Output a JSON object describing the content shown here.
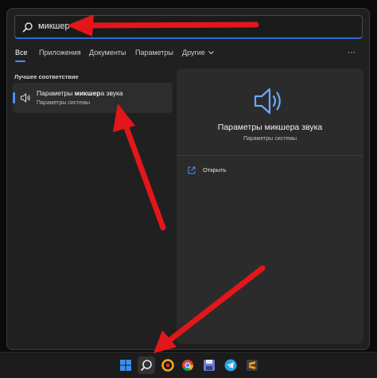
{
  "search": {
    "value": "микшер"
  },
  "tabs": [
    {
      "label": "Все",
      "active": true
    },
    {
      "label": "Приложения"
    },
    {
      "label": "Документы"
    },
    {
      "label": "Параметры"
    },
    {
      "label": "Другие"
    }
  ],
  "tabs_more_icon": "chevron-down-icon",
  "overflow_menu": "⋯",
  "best_match": {
    "section_title": "Лучшее соответствие",
    "title_prefix": "Параметры ",
    "title_bold": "микшер",
    "title_suffix": "а звука",
    "subtitle": "Параметры системы",
    "icon": "speaker-icon"
  },
  "detail": {
    "title": "Параметры микшера звука",
    "subtitle": "Параметры системы",
    "open_label": "Открыть",
    "icon": "speaker-icon"
  },
  "taskbar": {
    "icons": [
      "windows-start-icon",
      "search-icon",
      "yandex-browser-icon",
      "chrome-icon",
      "save-icon",
      "telegram-icon",
      "sublime-text-icon"
    ]
  },
  "colors": {
    "accent": "#4d8ef7",
    "arrow": "#e3161a",
    "panel": "#202020"
  }
}
